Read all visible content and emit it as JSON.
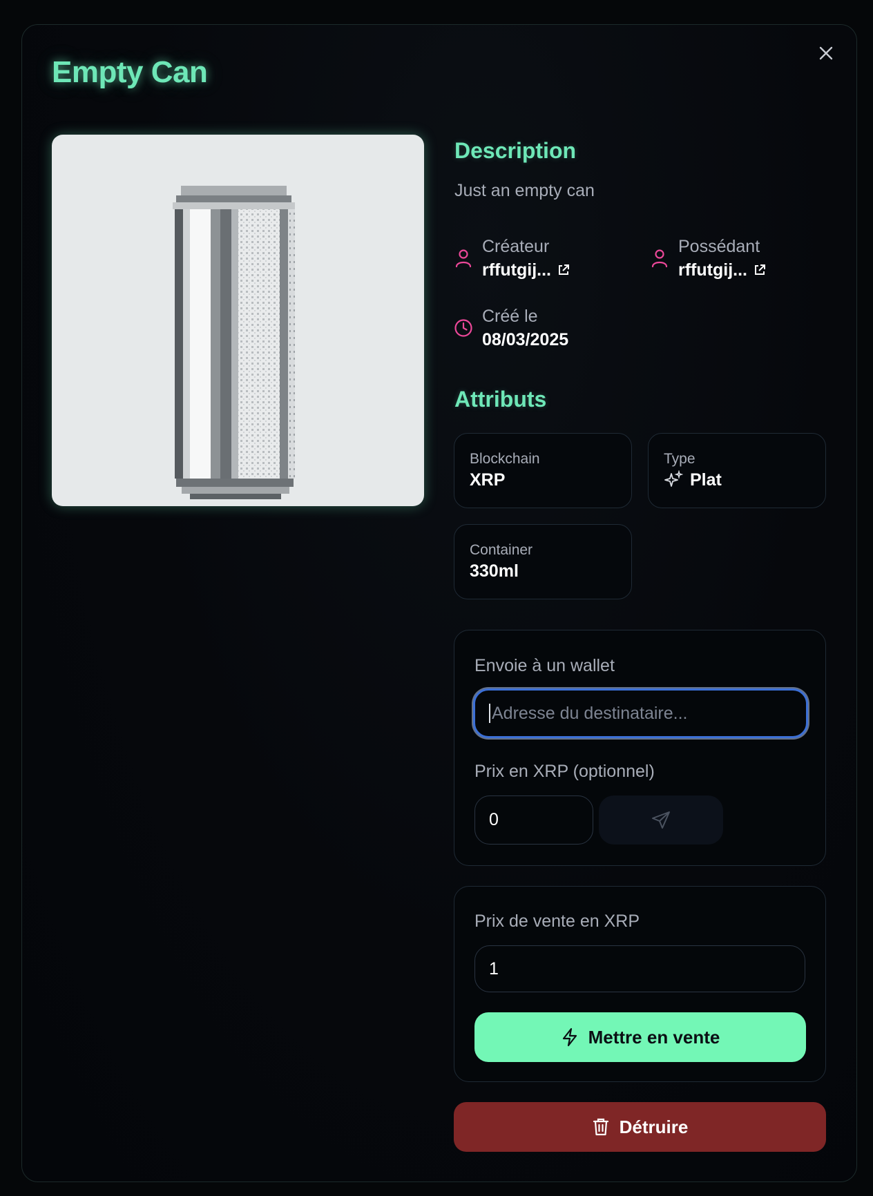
{
  "modal": {
    "title": "Empty Can",
    "close_icon": "close-icon"
  },
  "image": {
    "icon": "pixel-can-image"
  },
  "description": {
    "heading": "Description",
    "text": "Just an empty can"
  },
  "meta": {
    "creator_label": "Créateur",
    "creator_value": "rffutgij...",
    "owner_label": "Possédant",
    "owner_value": "rffutgij...",
    "created_label": "Créé le",
    "created_value": "08/03/2025"
  },
  "attributes": {
    "heading": "Attributs",
    "items": [
      {
        "label": "Blockchain",
        "value": "XRP"
      },
      {
        "label": "Type",
        "value": "Plat",
        "icon": "sparkles-icon"
      },
      {
        "label": "Container",
        "value": "330ml"
      }
    ]
  },
  "transfer": {
    "label": "Envoie à un wallet",
    "address_placeholder": "Adresse du destinataire...",
    "price_label": "Prix en XRP (optionnel)",
    "price_value": "0",
    "send_icon": "send-icon"
  },
  "sale": {
    "label": "Prix de vente en XRP",
    "price_value": "1",
    "button_label": "Mettre en vente",
    "button_icon": "lightning-icon"
  },
  "destroy": {
    "button_label": "Détruire",
    "button_icon": "trash-icon"
  },
  "colors": {
    "accent": "#6ee7b7",
    "pink_icon": "#ec4899",
    "sell_button": "#73f7b6",
    "destroy_button": "#7f2626",
    "background": "#050709"
  }
}
